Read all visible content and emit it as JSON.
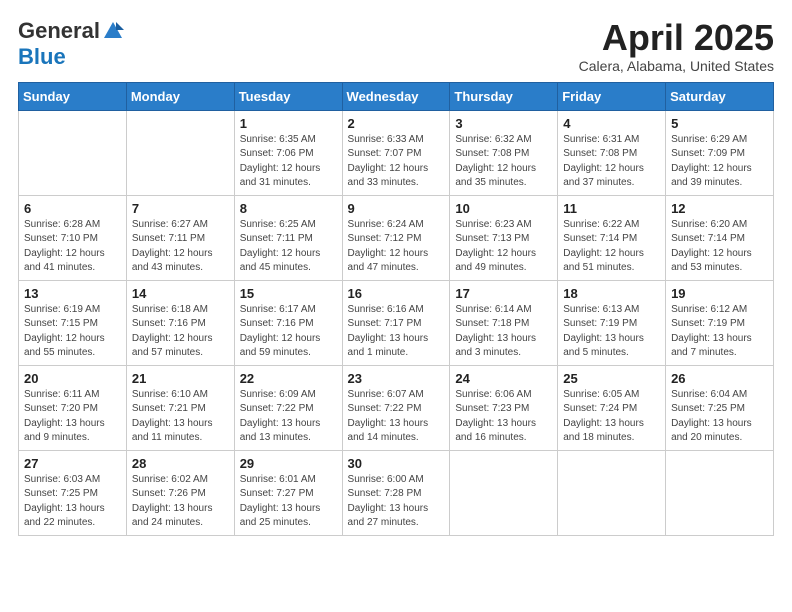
{
  "logo": {
    "general": "General",
    "blue": "Blue"
  },
  "title": "April 2025",
  "location": "Calera, Alabama, United States",
  "days_of_week": [
    "Sunday",
    "Monday",
    "Tuesday",
    "Wednesday",
    "Thursday",
    "Friday",
    "Saturday"
  ],
  "weeks": [
    [
      {
        "day": "",
        "info": ""
      },
      {
        "day": "",
        "info": ""
      },
      {
        "day": "1",
        "info": "Sunrise: 6:35 AM\nSunset: 7:06 PM\nDaylight: 12 hours and 31 minutes."
      },
      {
        "day": "2",
        "info": "Sunrise: 6:33 AM\nSunset: 7:07 PM\nDaylight: 12 hours and 33 minutes."
      },
      {
        "day": "3",
        "info": "Sunrise: 6:32 AM\nSunset: 7:08 PM\nDaylight: 12 hours and 35 minutes."
      },
      {
        "day": "4",
        "info": "Sunrise: 6:31 AM\nSunset: 7:08 PM\nDaylight: 12 hours and 37 minutes."
      },
      {
        "day": "5",
        "info": "Sunrise: 6:29 AM\nSunset: 7:09 PM\nDaylight: 12 hours and 39 minutes."
      }
    ],
    [
      {
        "day": "6",
        "info": "Sunrise: 6:28 AM\nSunset: 7:10 PM\nDaylight: 12 hours and 41 minutes."
      },
      {
        "day": "7",
        "info": "Sunrise: 6:27 AM\nSunset: 7:11 PM\nDaylight: 12 hours and 43 minutes."
      },
      {
        "day": "8",
        "info": "Sunrise: 6:25 AM\nSunset: 7:11 PM\nDaylight: 12 hours and 45 minutes."
      },
      {
        "day": "9",
        "info": "Sunrise: 6:24 AM\nSunset: 7:12 PM\nDaylight: 12 hours and 47 minutes."
      },
      {
        "day": "10",
        "info": "Sunrise: 6:23 AM\nSunset: 7:13 PM\nDaylight: 12 hours and 49 minutes."
      },
      {
        "day": "11",
        "info": "Sunrise: 6:22 AM\nSunset: 7:14 PM\nDaylight: 12 hours and 51 minutes."
      },
      {
        "day": "12",
        "info": "Sunrise: 6:20 AM\nSunset: 7:14 PM\nDaylight: 12 hours and 53 minutes."
      }
    ],
    [
      {
        "day": "13",
        "info": "Sunrise: 6:19 AM\nSunset: 7:15 PM\nDaylight: 12 hours and 55 minutes."
      },
      {
        "day": "14",
        "info": "Sunrise: 6:18 AM\nSunset: 7:16 PM\nDaylight: 12 hours and 57 minutes."
      },
      {
        "day": "15",
        "info": "Sunrise: 6:17 AM\nSunset: 7:16 PM\nDaylight: 12 hours and 59 minutes."
      },
      {
        "day": "16",
        "info": "Sunrise: 6:16 AM\nSunset: 7:17 PM\nDaylight: 13 hours and 1 minute."
      },
      {
        "day": "17",
        "info": "Sunrise: 6:14 AM\nSunset: 7:18 PM\nDaylight: 13 hours and 3 minutes."
      },
      {
        "day": "18",
        "info": "Sunrise: 6:13 AM\nSunset: 7:19 PM\nDaylight: 13 hours and 5 minutes."
      },
      {
        "day": "19",
        "info": "Sunrise: 6:12 AM\nSunset: 7:19 PM\nDaylight: 13 hours and 7 minutes."
      }
    ],
    [
      {
        "day": "20",
        "info": "Sunrise: 6:11 AM\nSunset: 7:20 PM\nDaylight: 13 hours and 9 minutes."
      },
      {
        "day": "21",
        "info": "Sunrise: 6:10 AM\nSunset: 7:21 PM\nDaylight: 13 hours and 11 minutes."
      },
      {
        "day": "22",
        "info": "Sunrise: 6:09 AM\nSunset: 7:22 PM\nDaylight: 13 hours and 13 minutes."
      },
      {
        "day": "23",
        "info": "Sunrise: 6:07 AM\nSunset: 7:22 PM\nDaylight: 13 hours and 14 minutes."
      },
      {
        "day": "24",
        "info": "Sunrise: 6:06 AM\nSunset: 7:23 PM\nDaylight: 13 hours and 16 minutes."
      },
      {
        "day": "25",
        "info": "Sunrise: 6:05 AM\nSunset: 7:24 PM\nDaylight: 13 hours and 18 minutes."
      },
      {
        "day": "26",
        "info": "Sunrise: 6:04 AM\nSunset: 7:25 PM\nDaylight: 13 hours and 20 minutes."
      }
    ],
    [
      {
        "day": "27",
        "info": "Sunrise: 6:03 AM\nSunset: 7:25 PM\nDaylight: 13 hours and 22 minutes."
      },
      {
        "day": "28",
        "info": "Sunrise: 6:02 AM\nSunset: 7:26 PM\nDaylight: 13 hours and 24 minutes."
      },
      {
        "day": "29",
        "info": "Sunrise: 6:01 AM\nSunset: 7:27 PM\nDaylight: 13 hours and 25 minutes."
      },
      {
        "day": "30",
        "info": "Sunrise: 6:00 AM\nSunset: 7:28 PM\nDaylight: 13 hours and 27 minutes."
      },
      {
        "day": "",
        "info": ""
      },
      {
        "day": "",
        "info": ""
      },
      {
        "day": "",
        "info": ""
      }
    ]
  ]
}
